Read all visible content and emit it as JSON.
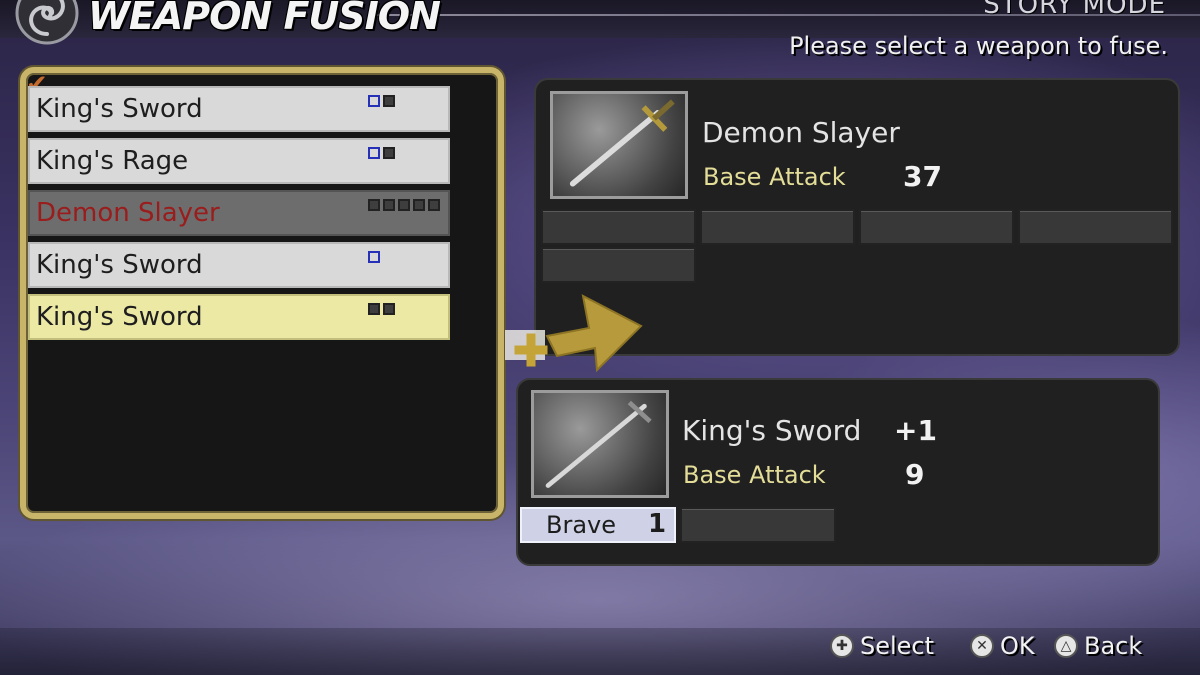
{
  "header": {
    "title": "WEAPON FUSION",
    "mode": "STORY MODE",
    "instruction": "Please select a weapon to fuse."
  },
  "weapon_list": {
    "items": [
      {
        "name": "King's Sword",
        "slots": [
          "blue-empty",
          "filled"
        ],
        "state": "normal"
      },
      {
        "name": "King's Rage",
        "slots": [
          "blue-empty",
          "filled"
        ],
        "state": "normal"
      },
      {
        "name": "Demon Slayer",
        "slots": [
          "filled",
          "filled",
          "filled",
          "filled",
          "filled"
        ],
        "state": "disabled"
      },
      {
        "name": "King's Sword",
        "slots": [
          "blue-empty"
        ],
        "state": "normal"
      },
      {
        "name": "King's Sword",
        "slots": [
          "filled",
          "filled"
        ],
        "state": "highlighted"
      }
    ]
  },
  "result": {
    "weapon_name": "Demon Slayer",
    "stat_label": "Base Attack",
    "base_attack": "37",
    "ability_slot_count": 5
  },
  "material": {
    "weapon_name": "King's Sword",
    "bonus": "+1",
    "stat_label": "Base Attack",
    "base_attack": "9",
    "ability": "Brave",
    "ability_level": "1"
  },
  "footer": {
    "select_label": "Select",
    "ok_label": "OK",
    "back_label": "Back"
  },
  "colors": {
    "frame_gold": "#c8b56a",
    "stat_label": "#e3dd98",
    "disabled_text": "#9a1d1d",
    "highlight_row": "#ece9a5",
    "ability_tag": "#cfd2e6"
  },
  "icons": {
    "logo": "swirl-emblem-icon",
    "arrow": "gold-plus-arrow-icon",
    "dpad": "dpad-icon",
    "ok": "cross-button-icon",
    "back": "triangle-button-icon"
  }
}
